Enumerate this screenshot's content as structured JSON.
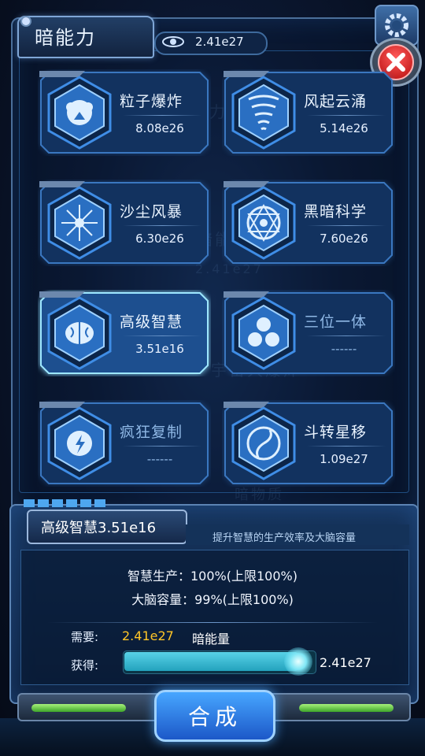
{
  "header": {
    "title": "暗能力",
    "resource_value": "2.41e27"
  },
  "buttons": {
    "settings_icon": "gear-icon",
    "close_icon": "close-icon"
  },
  "background_ghost": {
    "text1": "暗能力",
    "text2": "暗能",
    "text3": "2.41e27",
    "text4": "宇宙大爆炸",
    "text5": "暗物质"
  },
  "skills": [
    {
      "name": "粒子爆炸",
      "value": "8.08e26",
      "icon": "particle-explosion-icon"
    },
    {
      "name": "风起云涌",
      "value": "5.14e26",
      "icon": "tornado-icon"
    },
    {
      "name": "沙尘风暴",
      "value": "6.30e26",
      "icon": "sandstorm-icon"
    },
    {
      "name": "黑暗科学",
      "value": "7.60e26",
      "icon": "dark-science-icon"
    },
    {
      "name": "高级智慧",
      "value": "3.51e16",
      "icon": "brain-icon"
    },
    {
      "name": "三位一体",
      "value": "------",
      "icon": "trinity-icon"
    },
    {
      "name": "疯狂复制",
      "value": "------",
      "icon": "lightning-icon"
    },
    {
      "name": "斗转星移",
      "value": "1.09e27",
      "icon": "spiral-icon"
    }
  ],
  "selected": {
    "title": "高级智慧3.51e16",
    "description": "提升智慧的生产效率及大脑容量",
    "stat1": "智慧生产：100%(上限100%)",
    "stat2": "大脑容量：99%(上限100%)",
    "need_label": "需要:",
    "need_value": "2.41e27",
    "need_unit": "暗能量",
    "gain_label": "获得:",
    "gain_value": "2.41e27",
    "gain_fraction": 0.92
  },
  "actions": {
    "synthesize": "合成"
  },
  "colors": {
    "accent": "#2e8ae6",
    "need_value": "#ffc627",
    "slider": "#3cc0d8"
  }
}
